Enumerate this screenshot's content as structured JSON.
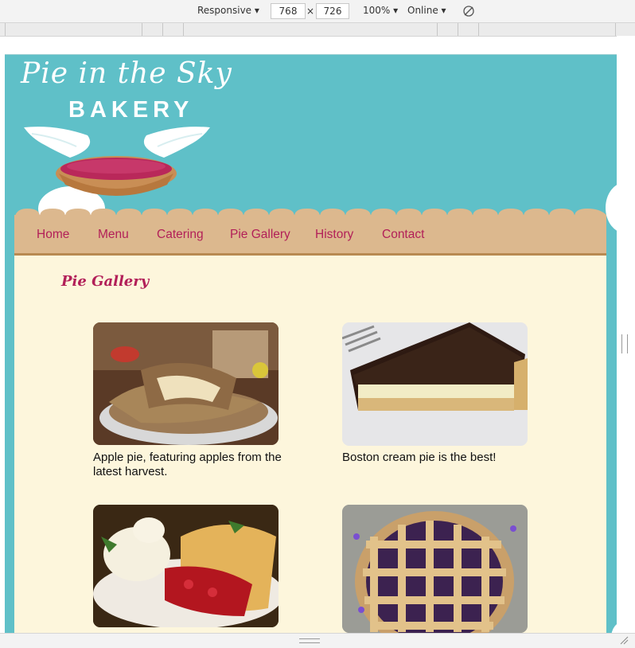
{
  "devtools": {
    "device_mode": "Responsive",
    "width": "768",
    "times": "×",
    "height": "726",
    "zoom": "100%",
    "throttle": "Online"
  },
  "logo": {
    "line1": "Pie in the Sky",
    "line2": "BAKERY"
  },
  "nav": {
    "items": [
      {
        "label": "Home"
      },
      {
        "label": "Menu"
      },
      {
        "label": "Catering"
      },
      {
        "label": "Pie Gallery"
      },
      {
        "label": "History"
      },
      {
        "label": "Contact"
      }
    ]
  },
  "page": {
    "title": "Pie Gallery"
  },
  "gallery": [
    {
      "caption": "Apple pie, featuring apples from the latest harvest.",
      "image": "apple-pie-photo"
    },
    {
      "caption": "Boston cream pie is the best!",
      "image": "boston-cream-pie-photo"
    },
    {
      "caption": "",
      "image": "cherry-pie-ice-cream-photo"
    },
    {
      "caption": "",
      "image": "lattice-berry-pie-photo"
    }
  ],
  "colors": {
    "sky": "#5fc0c8",
    "nav_bg": "#dcb88e",
    "content_bg": "#fdf6dc",
    "accent": "#b21f58"
  }
}
